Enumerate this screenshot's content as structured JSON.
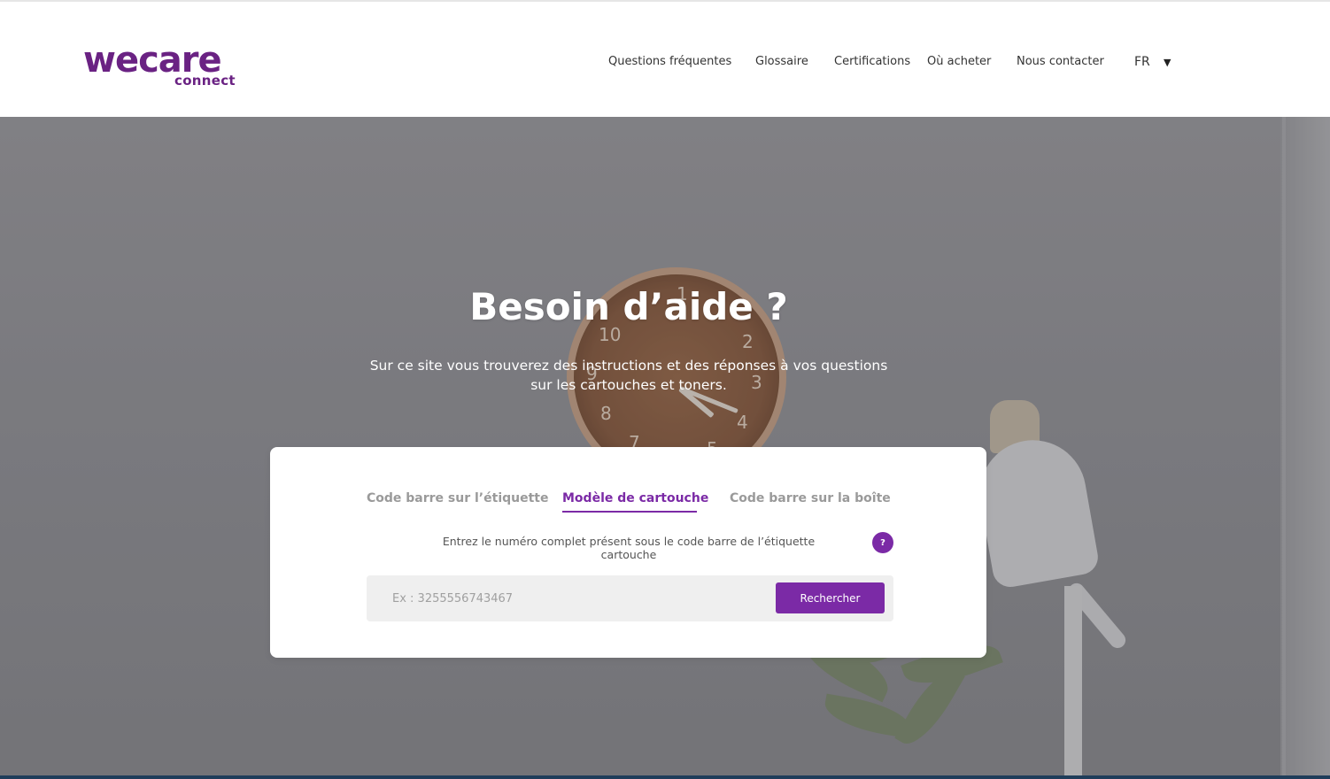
{
  "brand": {
    "logo_main": "wecare",
    "logo_sub": "connect",
    "color": "#6a2283"
  },
  "nav": {
    "items": [
      "Questions fréquentes",
      "Glossaire",
      "Certifications",
      "Où acheter",
      "Nous contacter"
    ],
    "language": "FR",
    "language_caret": "▼"
  },
  "hero": {
    "title": "Besoin d’aide ?",
    "subtitle_line1": "Sur ce site vous trouverez des instructions et des réponses à vos questions",
    "subtitle_line2": "sur les cartouches et toners.",
    "clock_numbers": [
      "1",
      "2",
      "3",
      "4",
      "5",
      "7",
      "8",
      "9",
      "10"
    ]
  },
  "search": {
    "tabs": [
      "Code barre sur l’étiquette",
      "Modèle de cartouche",
      "Code barre sur la boîte"
    ],
    "active_tab_index": 1,
    "instruction": "Entrez le numéro complet présent sous le code barre de l’étiquette cartouche",
    "help_label": "?",
    "placeholder": "Ex : 3255556743467",
    "button_label": "Rechercher",
    "accent_color": "#7b2aa6"
  }
}
